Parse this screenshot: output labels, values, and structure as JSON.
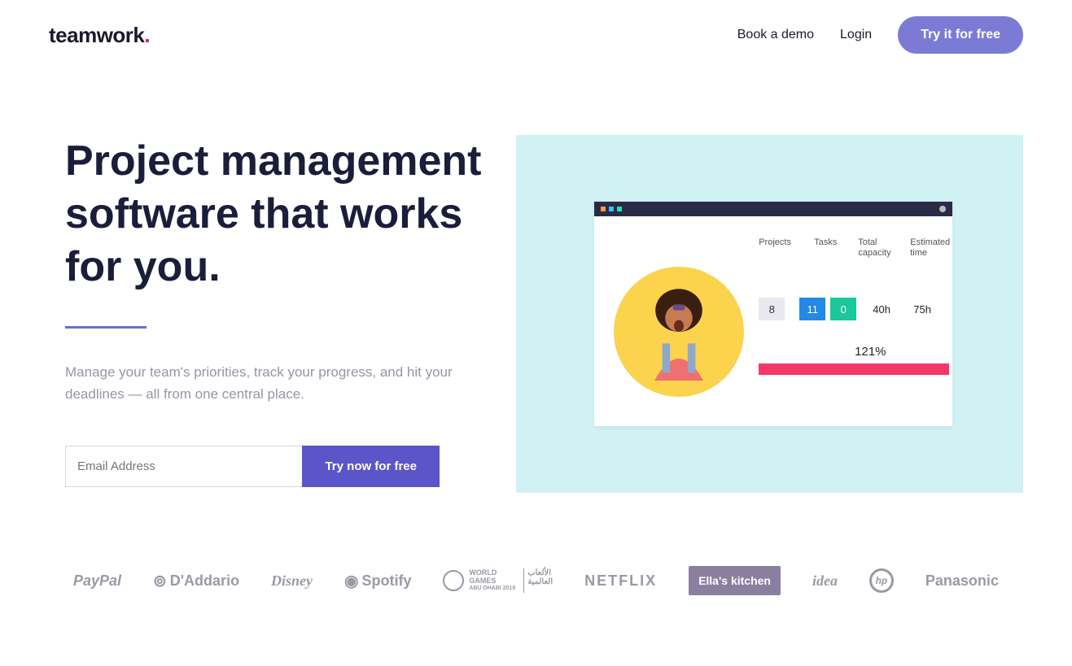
{
  "header": {
    "logo_text": "teamwork",
    "logo_dot": ".",
    "nav": {
      "book_demo": "Book a demo",
      "login": "Login",
      "try_free": "Try it for free"
    }
  },
  "hero": {
    "title": "Project management software that works for you.",
    "subtitle": "Manage your team's priorities, track your progress, and hit your deadlines — all from one central place.",
    "email_placeholder": "Email Address",
    "cta": "Try now for free"
  },
  "app_preview": {
    "headers": {
      "projects": "Projects",
      "tasks": "Tasks",
      "capacity": "Total capacity",
      "estimated": "Estimated time"
    },
    "row": {
      "projects": "8",
      "tasks_a": "11",
      "tasks_b": "0",
      "capacity": "40h",
      "estimated": "75h"
    },
    "percent": "121%"
  },
  "brands": {
    "paypal": "PayPal",
    "daddario": "D'Addario",
    "disney": "Disney",
    "spotify": "Spotify",
    "worldgames_a": "WORLD",
    "worldgames_b": "GAMES",
    "worldgames_c": "ABU DHABI 2019",
    "netflix": "NETFLIX",
    "ella": "Ella's kitchen",
    "idea": "idea",
    "hp": "hp",
    "panasonic": "Panasonic"
  }
}
